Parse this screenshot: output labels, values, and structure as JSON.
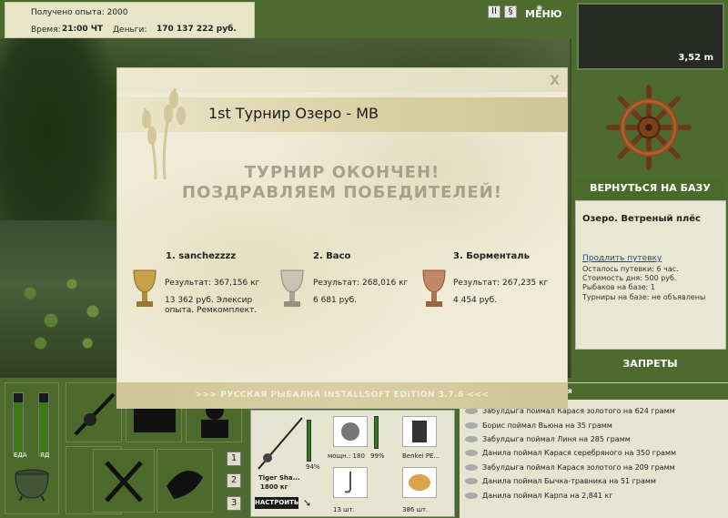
{
  "stats": {
    "exp_label": "Получено опыта: 2000",
    "time_label": "Время:",
    "time_value": "21:00 ЧТ",
    "money_label": "Деньги:",
    "money_value": "170 137 222 руб."
  },
  "top_icons": {
    "pause": "II",
    "sound": "§",
    "menu_label": "МЕНЮ"
  },
  "depth": "3,52 m",
  "return_button": "ВЕРНУТЬСЯ НА БАЗУ",
  "info": {
    "location": "Озеро. Ветреный плёс",
    "extend_link": "Продлить путевку",
    "lines": [
      "Осталось путевки: 6 час.",
      "Стоимость дня: 500 руб.",
      "Рыбаков на базе: 1",
      "Турниры на базе: не объявлены"
    ]
  },
  "bans_button": "ЗАПРЕТЫ",
  "gauges": {
    "food_label": "ЕДА",
    "poison_label": "ЯД",
    "food_level": 0.85,
    "poison_level": 0.85
  },
  "pages": [
    "1",
    "2",
    "3"
  ],
  "tackle": {
    "rod_name": "Tiger Sha...",
    "rod_weight": "1800 кг",
    "rod_pct": "94%",
    "reel_caption": "мощн.: 180",
    "reel_pct": "99%",
    "line_caption": "Benkei PE...",
    "hook_caption": "13 шт.",
    "bait_caption": "386 шт.",
    "setup_button": "НАСТРОИТЬ"
  },
  "chat": {
    "header": "ия",
    "lines": [
      "Забулдыга поймал Карася золотого на 624 грамм",
      "Борис поймал Вьюна на 35 грамм",
      "Забулдыга поймал Линя на 285 грамм",
      "Данила поймал Карася серебряного на 350 грамм",
      "Забулдыга поймал Карася золотого на 209 грамм",
      "Данила поймал Бычка-травника на 51 грамм",
      "Данила поймал Карпа на 2,841 кг"
    ]
  },
  "modal": {
    "title": "1st Турнир Озеро - МВ",
    "close": "X",
    "headline1": "ТУРНИР ОКОНЧЕН!",
    "headline2": "ПОЗДРАВЛЯЕМ ПОБЕДИТЕЛЕЙ!",
    "winners": [
      {
        "name": "1. sanchezzzz",
        "result": "Результат: 367,156 кг",
        "prize": "13 362 руб. Элексир опыта. Ремкомплект."
      },
      {
        "name": "2. Васо",
        "result": "Результат: 268,016 кг",
        "prize": "6 681 руб."
      },
      {
        "name": "3. Борменталь",
        "result": "Результат: 267,235 кг",
        "prize": "4 454 руб."
      }
    ],
    "footer": ">>> РУССКАЯ РЫБАЛКА INSTALLSOFT EDITION 3.7.6 <<<"
  },
  "colors": {
    "panel_green": "#4e6b2f",
    "gold_cup": "#c8a24a",
    "silver_cup": "#c9c3b5",
    "bronze_cup": "#c08864"
  }
}
